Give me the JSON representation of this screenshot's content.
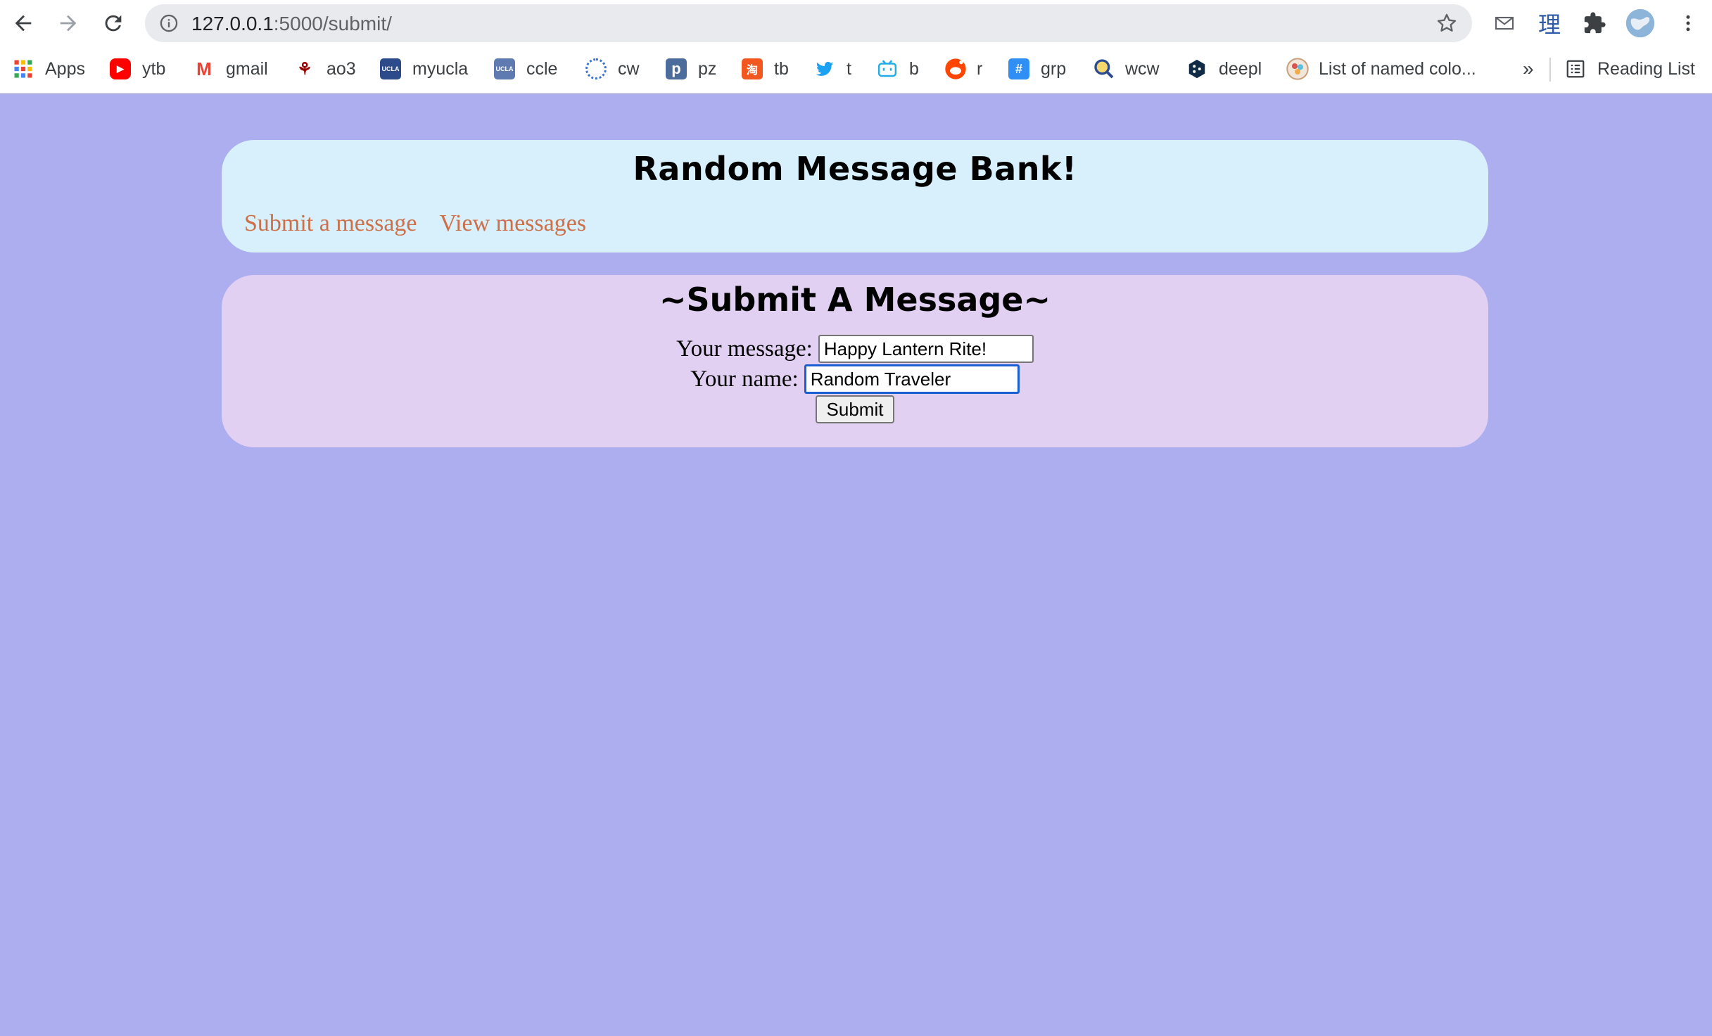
{
  "browser": {
    "url_host": "127.0.0.1",
    "url_path": ":5000/submit/",
    "bookmarks": [
      {
        "label": "Apps",
        "icon": "apps-grid-icon",
        "color": "#EA4335"
      },
      {
        "label": "ytb",
        "icon": "youtube-icon",
        "color": "#FF0000"
      },
      {
        "label": "gmail",
        "icon": "gmail-icon",
        "color": "#EA4335"
      },
      {
        "label": "ao3",
        "icon": "ao3-icon",
        "color": "#990000"
      },
      {
        "label": "myucla",
        "icon": "ucla-icon",
        "color": "#2D4A8A"
      },
      {
        "label": "ccle",
        "icon": "ucla-icon",
        "color": "#5E7AB0"
      },
      {
        "label": "cw",
        "icon": "cw-icon",
        "color": "#3B6FD6"
      },
      {
        "label": "pz",
        "icon": "p-icon",
        "color": "#4C6C9C"
      },
      {
        "label": "tb",
        "icon": "tb-icon",
        "color": "#F2571F"
      },
      {
        "label": "t",
        "icon": "twitter-icon",
        "color": "#1DA1F2"
      },
      {
        "label": "b",
        "icon": "bilibili-icon",
        "color": "#23ADE5"
      },
      {
        "label": "r",
        "icon": "reddit-icon",
        "color": "#FF4500"
      },
      {
        "label": "grp",
        "icon": "grp-icon",
        "color": "#2F8FF5"
      },
      {
        "label": "wcw",
        "icon": "wcw-icon",
        "color": "#2C4A8F"
      },
      {
        "label": "deepl",
        "icon": "deepl-icon",
        "color": "#0F2B46"
      },
      {
        "label": "List of named colo...",
        "icon": "colors-icon",
        "color": "#C9A07A"
      }
    ],
    "overflow_label": "»",
    "reading_list_label": "Reading List"
  },
  "header": {
    "title": "Random Message Bank!",
    "links": [
      "Submit a message",
      "View messages"
    ]
  },
  "form": {
    "title": "~Submit A Message~",
    "message_label": "Your message:",
    "message_value": "Happy Lantern Rite!",
    "name_label": "Your name:",
    "name_value": "Random Traveler",
    "submit_label": "Submit"
  },
  "colors": {
    "page_bg": "#ADAEEF",
    "header_card": "#D7F0FB",
    "form_card": "#E1D0F2",
    "link": "#CD6F48"
  }
}
